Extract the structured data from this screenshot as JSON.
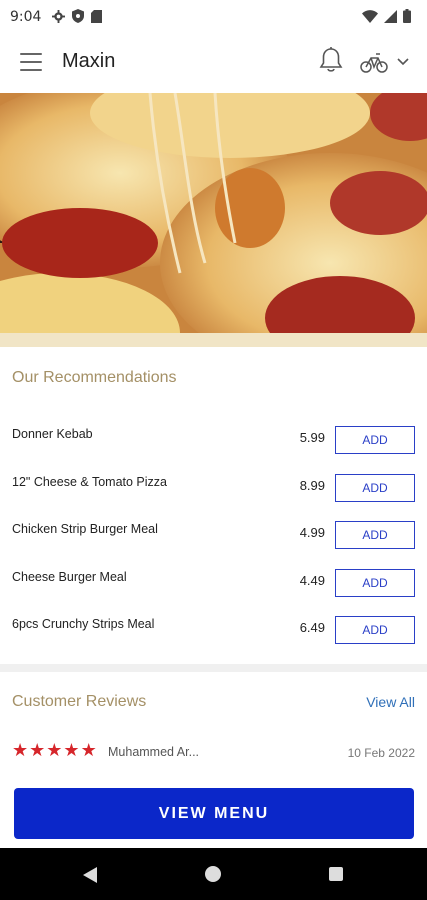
{
  "status_bar": {
    "time": "9:04",
    "left_icons": [
      "gear-icon",
      "shield-icon",
      "sim-icon"
    ],
    "right_icons": [
      "wifi-icon",
      "signal-icon",
      "battery-icon"
    ]
  },
  "app_bar": {
    "title": "Maxin",
    "icons": [
      "menu-icon",
      "bell-icon",
      "bike-icon",
      "chevron-down-icon"
    ]
  },
  "hero": {
    "image": "pepperoni pizza with stretched cheese"
  },
  "recommendations": {
    "title": "Our Recommendations",
    "items": [
      {
        "name": "Donner Kebab",
        "price": "5.99",
        "button": "ADD"
      },
      {
        "name": "12\" Cheese & Tomato Pizza",
        "price": "8.99",
        "button": "ADD"
      },
      {
        "name": "Chicken Strip Burger Meal",
        "price": "4.99",
        "button": "ADD"
      },
      {
        "name": "Cheese Burger Meal",
        "price": "4.49",
        "button": "ADD"
      },
      {
        "name": "6pcs Crunchy Strips Meal",
        "price": "6.49",
        "button": "ADD"
      }
    ]
  },
  "reviews": {
    "title": "Customer Reviews",
    "view_all": "View All",
    "items": [
      {
        "rating": 5,
        "reviewer": "Muhammed Ar...",
        "date": "10 Feb 2022"
      }
    ]
  },
  "view_menu_button": "VIEW MENU",
  "colors": {
    "accent": "#0b27c9",
    "add_button": "#2a3fc7",
    "section_title": "#a49066",
    "link": "#2f6fb8",
    "star": "#d6262b"
  },
  "nav_bar": {
    "icons": [
      "back-icon",
      "home-icon",
      "recents-icon"
    ]
  }
}
